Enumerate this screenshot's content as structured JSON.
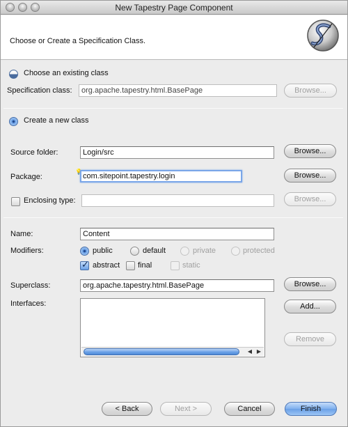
{
  "window": {
    "title": "New Tapestry Page Component"
  },
  "header": {
    "instruction": "Choose or Create a Specification Class."
  },
  "existing": {
    "radio_label": "Choose an existing class",
    "spec_label": "Specification class:",
    "spec_value": "org.apache.tapestry.html.BasePage",
    "browse_label": "Browse..."
  },
  "create": {
    "radio_label": "Create a new class",
    "source_folder_label": "Source folder:",
    "source_folder_value": "Login/src",
    "package_label": "Package:",
    "package_value": "com.sitepoint.tapestry.login",
    "enclosing_label": "Enclosing type:",
    "enclosing_value": "",
    "browse_label": "Browse..."
  },
  "class": {
    "name_label": "Name:",
    "name_value": "Content",
    "modifiers_label": "Modifiers:",
    "mod_public": "public",
    "mod_default": "default",
    "mod_private": "private",
    "mod_protected": "protected",
    "mod_abstract": "abstract",
    "mod_final": "final",
    "mod_static": "static",
    "superclass_label": "Superclass:",
    "superclass_value": "org.apache.tapestry.html.BasePage",
    "interfaces_label": "Interfaces:",
    "browse_label": "Browse...",
    "add_label": "Add...",
    "remove_label": "Remove"
  },
  "footer": {
    "back_label": "< Back",
    "next_label": "Next >",
    "cancel_label": "Cancel",
    "finish_label": "Finish"
  },
  "icons": {
    "logo": "tapestry-logo-icon",
    "bulb": "lightbulb-icon"
  },
  "colors": {
    "accent": "#6aa0e6",
    "focus_ring": "#7aa6e8"
  }
}
